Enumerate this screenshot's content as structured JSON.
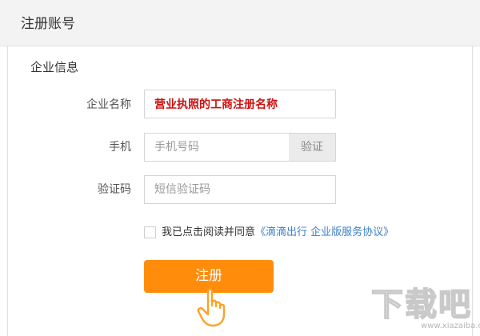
{
  "header": {
    "title": "注册账号"
  },
  "form": {
    "section_title": "企业信息",
    "company_name": {
      "label": "企业名称",
      "value": "营业执照的工商注册名称"
    },
    "phone": {
      "label": "手机",
      "placeholder": "手机号码",
      "verify_label": "验证"
    },
    "code": {
      "label": "验证码",
      "placeholder": "短信验证码"
    },
    "agreement": {
      "text": "我已点击阅读并同意",
      "link": "《滴滴出行 企业版服务协议》"
    },
    "submit_label": "注册"
  },
  "watermark": {
    "logo_text": "下载吧",
    "url": "www.xiazaiba.com"
  },
  "icons": {
    "pointer": "hand-pointer-icon",
    "checkbox": "checkbox-icon"
  },
  "colors": {
    "accent": "#ff8d0b",
    "link": "#3a7fc8",
    "company_value": "#cc1111"
  }
}
